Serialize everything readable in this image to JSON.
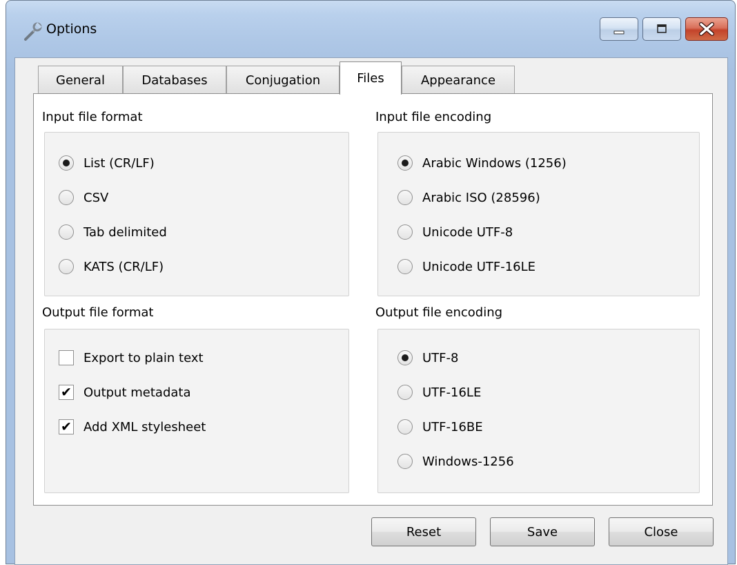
{
  "window": {
    "title": "Options",
    "controls": [
      "minimize",
      "maximize",
      "close"
    ]
  },
  "tabs": [
    {
      "label": "General",
      "selected": false
    },
    {
      "label": "Databases",
      "selected": false
    },
    {
      "label": "Conjugation",
      "selected": false
    },
    {
      "label": "Files",
      "selected": true
    },
    {
      "label": "Appearance",
      "selected": false
    }
  ],
  "input_format": {
    "title": "Input file format",
    "options": [
      {
        "label": "List (CR/LF)",
        "selected": true
      },
      {
        "label": "CSV",
        "selected": false
      },
      {
        "label": "Tab delimited",
        "selected": false
      },
      {
        "label": "KATS (CR/LF)",
        "selected": false
      }
    ]
  },
  "input_encoding": {
    "title": "Input file encoding",
    "options": [
      {
        "label": "Arabic Windows (1256)",
        "selected": true
      },
      {
        "label": "Arabic ISO (28596)",
        "selected": false
      },
      {
        "label": "Unicode UTF-8",
        "selected": false
      },
      {
        "label": "Unicode UTF-16LE",
        "selected": false
      }
    ]
  },
  "output_format": {
    "title": "Output file format",
    "options": [
      {
        "label": "Export to plain text",
        "checked": false
      },
      {
        "label": "Output metadata",
        "checked": true
      },
      {
        "label": "Add XML stylesheet",
        "checked": true
      }
    ]
  },
  "output_encoding": {
    "title": "Output file encoding",
    "options": [
      {
        "label": "UTF-8",
        "selected": true
      },
      {
        "label": "UTF-16LE",
        "selected": false
      },
      {
        "label": "UTF-16BE",
        "selected": false
      },
      {
        "label": "Windows-1256",
        "selected": false
      }
    ]
  },
  "buttons": {
    "reset": "Reset",
    "save": "Save",
    "close": "Close"
  }
}
